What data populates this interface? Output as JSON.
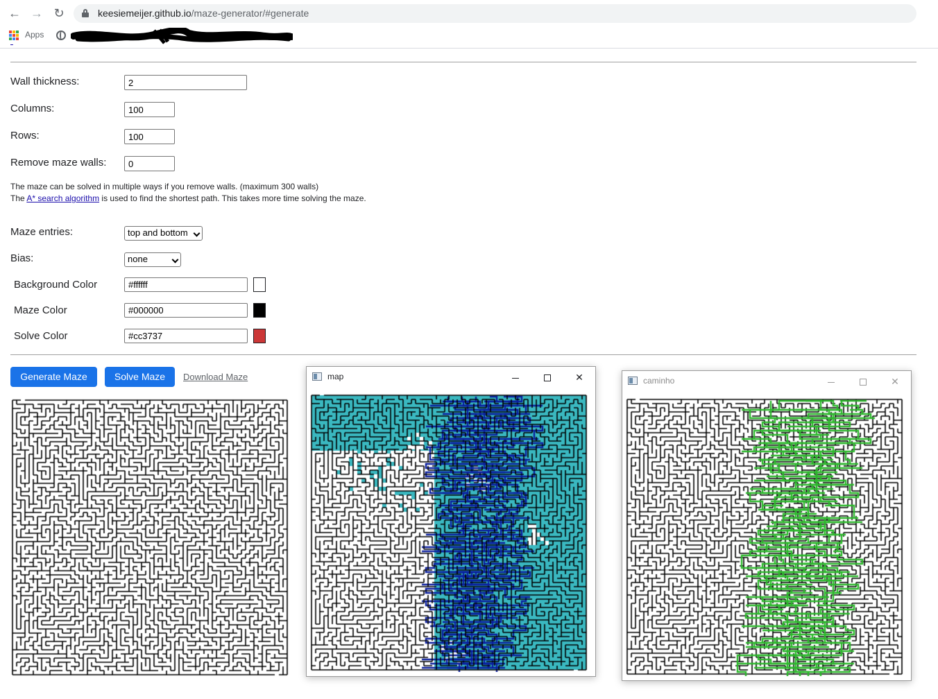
{
  "browser": {
    "url_host": "keesiemeijer.github.io",
    "url_path": "/maze-generator/#generate",
    "bookmarks": {
      "apps_label": "Apps"
    }
  },
  "form": {
    "wall_thickness": {
      "label": "Wall thickness:",
      "value": "2"
    },
    "columns": {
      "label": "Columns:",
      "value": "100"
    },
    "rows": {
      "label": "Rows:",
      "value": "100"
    },
    "remove_walls": {
      "label": "Remove maze walls:",
      "value": "0"
    },
    "note_line1": "The maze can be solved in multiple ways if you remove walls. (maximum 300 walls)",
    "note_line2_pre": "The ",
    "note_line2_link": "A* search algorithm",
    "note_line2_post": " is used to find the shortest path. This takes more time solving the maze.",
    "maze_entries": {
      "label": "Maze entries:",
      "selected": "top and bottom"
    },
    "bias": {
      "label": "Bias:",
      "selected": "none"
    },
    "background_color": {
      "label": "Background Color",
      "value": "#ffffff",
      "swatch": "#ffffff"
    },
    "maze_color": {
      "label": "Maze Color",
      "value": "#000000",
      "swatch": "#000000"
    },
    "solve_color": {
      "label": "Solve Color",
      "value": "#cc3737",
      "swatch": "#cc3737"
    }
  },
  "actions": {
    "generate_label": "Generate Maze",
    "solve_label": "Solve Maze",
    "download_label": "Download Maze"
  },
  "windows": {
    "map": {
      "title": "map",
      "visited_color": "#3ab8c0",
      "path_color": "#0b1f9e"
    },
    "caminho": {
      "title": "caminho",
      "path_color": "#2bb82b"
    }
  },
  "colors": {
    "accent": "#1a73e8",
    "link": "#1a0dab"
  }
}
